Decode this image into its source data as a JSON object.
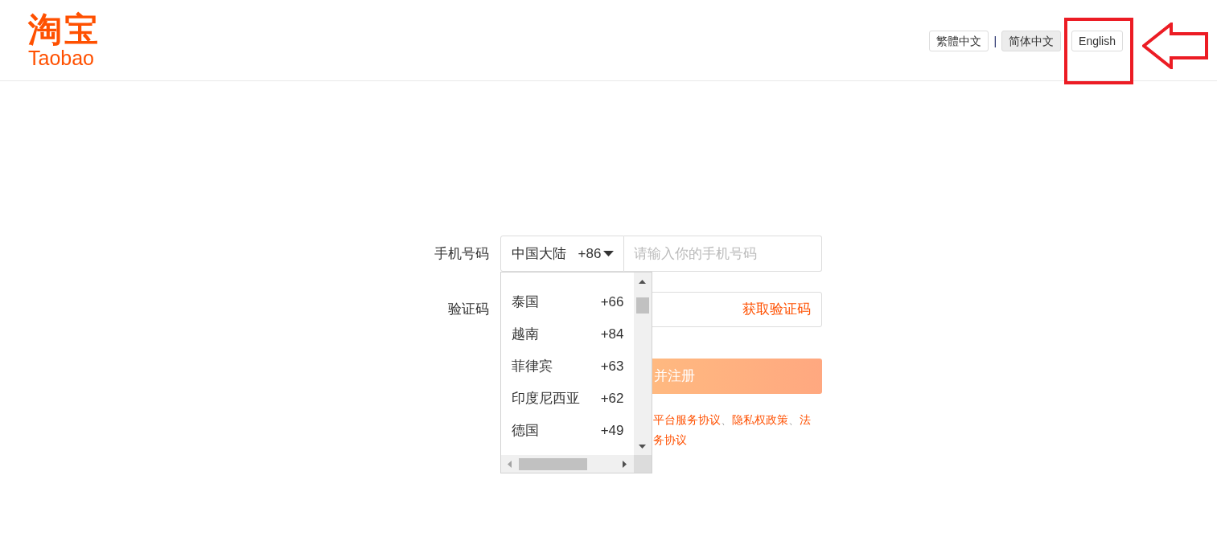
{
  "header": {
    "logo": {
      "mark": "淘宝",
      "wordmark": "Taobao"
    },
    "languages": [
      {
        "kind": "button",
        "label": "繁體中文",
        "selected": false,
        "highlighted": false
      },
      {
        "kind": "separator",
        "label": "|"
      },
      {
        "kind": "button",
        "label": "简体中文",
        "selected": true,
        "highlighted": false
      },
      {
        "kind": "button",
        "label": "English",
        "selected": false,
        "highlighted": true
      }
    ]
  },
  "form": {
    "phone": {
      "label": "手机号码",
      "country": "中国大陆",
      "code": "+86",
      "placeholder": "请输入你的手机号码"
    },
    "country_options": [
      {
        "name": "泰国",
        "code": "+66"
      },
      {
        "name": "越南",
        "code": "+84"
      },
      {
        "name": "菲律宾",
        "code": "+63"
      },
      {
        "name": "印度尼西亚",
        "code": "+62"
      },
      {
        "name": "德国",
        "code": "+49"
      }
    ],
    "verification": {
      "label": "验证码",
      "action": "获取验证码"
    },
    "submit": "并注册",
    "agreement": {
      "lines": [
        {
          "segments": [
            {
              "kind": "link",
              "text": "平台服务协议"
            },
            {
              "kind": "plain",
              "text": "、"
            },
            {
              "kind": "link",
              "text": "隐私权政策"
            },
            {
              "kind": "plain",
              "text": "、"
            },
            {
              "kind": "link",
              "text": "法"
            }
          ]
        },
        {
          "segments": [
            {
              "kind": "link",
              "text": "务协议"
            }
          ]
        }
      ]
    }
  }
}
